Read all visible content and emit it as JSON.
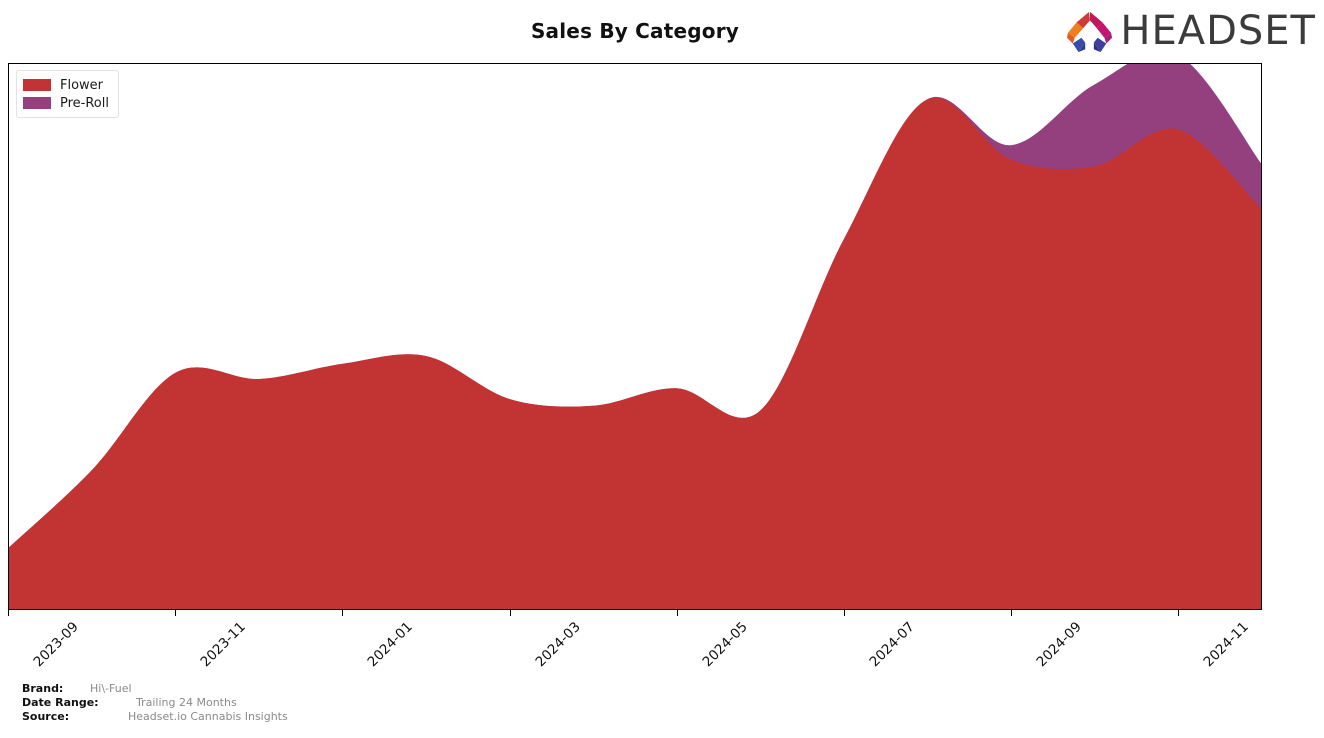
{
  "header": {
    "title": "Sales By Category",
    "logo_text": "HEADSET",
    "logo_mark_name": "headset-arch-logo"
  },
  "legend": {
    "position": "upper-left",
    "items": [
      {
        "label": "Flower",
        "color": "#C23333"
      },
      {
        "label": "Pre-Roll",
        "color": "#94407F"
      }
    ]
  },
  "footer": {
    "brand_key": "Brand:",
    "brand_value": "Hi\\-Fuel",
    "date_key": "Date Range:",
    "date_value": "Trailing 24 Months",
    "source_key": "Source:",
    "source_value": "Headset.io Cannabis Insights"
  },
  "chart_data": {
    "type": "area",
    "stacked": true,
    "title": "Sales By Category",
    "xlabel": "",
    "ylabel": "",
    "grid": false,
    "legend_position": "upper left",
    "x": [
      "2023-09",
      "2023-10",
      "2023-11",
      "2023-12",
      "2024-01",
      "2024-02",
      "2024-03",
      "2024-04",
      "2024-05",
      "2024-06",
      "2024-07",
      "2024-08",
      "2024-09",
      "2024-10",
      "2024-11",
      "2024-12"
    ],
    "tick_labels": [
      "2023-09",
      "2023-11",
      "2024-01",
      "2024-03",
      "2024-05",
      "2024-07",
      "2024-09",
      "2024-11"
    ],
    "tick_label_rotation": -45,
    "series": [
      {
        "name": "Flower",
        "color": "#C23333",
        "values": [
          11.3,
          25.6,
          43.4,
          42.2,
          45.0,
          46.4,
          38.5,
          37.3,
          40.5,
          36.4,
          67.8,
          93.5,
          82.5,
          81.2,
          88.0,
          73.5
        ]
      },
      {
        "name": "Pre-Roll",
        "color": "#94407F",
        "values": [
          0.0,
          0.0,
          0.0,
          0.0,
          0.0,
          0.0,
          0.0,
          0.0,
          0.0,
          0.0,
          0.0,
          0.0,
          2.6,
          15.0,
          13.7,
          8.3
        ]
      }
    ],
    "ylim": [
      0,
      100
    ],
    "axis_visible": {
      "x": true,
      "y": false
    },
    "y_tick_labels": []
  }
}
